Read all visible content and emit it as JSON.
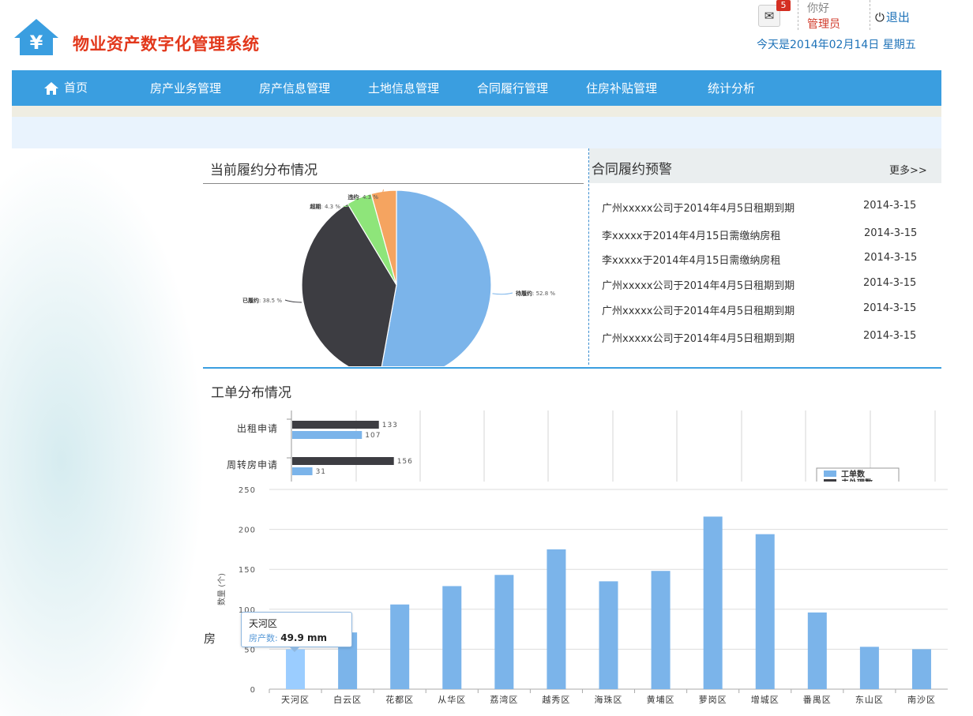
{
  "header": {
    "title": "物业资产数字化管理系统",
    "mail_count": "5",
    "greeting": "你好",
    "user": "管理员",
    "logout": "退出",
    "date": "今天是2014年02月14日 星期五",
    "logo_icon": "yen-house-icon"
  },
  "colors": {
    "nav": "#3a9ee0",
    "title": "#e2381c",
    "bar": "#7bb4ea",
    "dark_bar": "#3d3d42"
  },
  "nav": [
    {
      "label": "首页"
    },
    {
      "label": "房产业务管理"
    },
    {
      "label": "房产信息管理"
    },
    {
      "label": "土地信息管理"
    },
    {
      "label": "合同履行管理"
    },
    {
      "label": "住房补贴管理"
    },
    {
      "label": "统计分析"
    }
  ],
  "pie_panel": {
    "title": "当前履约分布情况"
  },
  "warn_panel": {
    "title": "合同履约预警",
    "more": "更多>>",
    "rows": [
      {
        "text": "广州xxxxx公司于2014年4月5日租期到期",
        "date": "2014-3-15"
      },
      {
        "text": "李xxxxx于2014年4月15日需缴纳房租",
        "date": "2014-3-15"
      },
      {
        "text": "李xxxxx于2014年4月15日需缴纳房租",
        "date": "2014-3-15"
      },
      {
        "text": "广州xxxxx公司于2014年4月5日租期到期",
        "date": "2014-3-15"
      },
      {
        "text": "广州xxxxx公司于2014年4月5日租期到期",
        "date": "2014-3-15"
      },
      {
        "text": "广州xxxxx公司于2014年4月5日租期到期",
        "date": "2014-3-15"
      }
    ]
  },
  "work_panel": {
    "title": "工单分布情况",
    "trunc_label": "房"
  },
  "tooltip": {
    "title": "天河区",
    "label": "房产数:",
    "value": "49.9 mm"
  },
  "chart_data": [
    {
      "type": "pie",
      "slices": [
        {
          "name": "待履约",
          "label": "待履约: 52.8 %",
          "value": 52.8,
          "color": "#7bb4ea"
        },
        {
          "name": "已履约",
          "label": "已履约: 38.5 %",
          "value": 38.5,
          "color": "#3d3d42"
        },
        {
          "name": "超期",
          "label": "超期: 4.3 %",
          "value": 4.3,
          "color": "#8ee57a"
        },
        {
          "name": "违约",
          "label": "违约: 4.3 %",
          "value": 4.3,
          "color": "#f5a460"
        }
      ]
    },
    {
      "type": "bar",
      "orientation": "horizontal",
      "categories": [
        "出租申请",
        "周转房申请"
      ],
      "series": [
        {
          "name": "工单数",
          "values": [
            133,
            156
          ],
          "color": "#3d3d42"
        },
        {
          "name": "",
          "values": [
            107,
            31
          ],
          "color": "#7bb4ea"
        }
      ],
      "legend": {
        "placement": "right",
        "items": [
          "工单数",
          "未处理数"
        ]
      }
    },
    {
      "type": "bar",
      "categories": [
        "天河区",
        "白云区",
        "花都区",
        "从华区",
        "荔湾区",
        "越秀区",
        "海珠区",
        "黄埔区",
        "萝岗区",
        "增城区",
        "番禺区",
        "东山区",
        "南沙区"
      ],
      "values": [
        49.9,
        71,
        106,
        129,
        143,
        175,
        135,
        148,
        216,
        194,
        96,
        53,
        50
      ],
      "highlight_index": 0,
      "ylabel": "数量 (个)",
      "ylim": [
        0,
        250
      ],
      "yticks": [
        0,
        50,
        100,
        150,
        200,
        250
      ],
      "grid": true
    }
  ]
}
